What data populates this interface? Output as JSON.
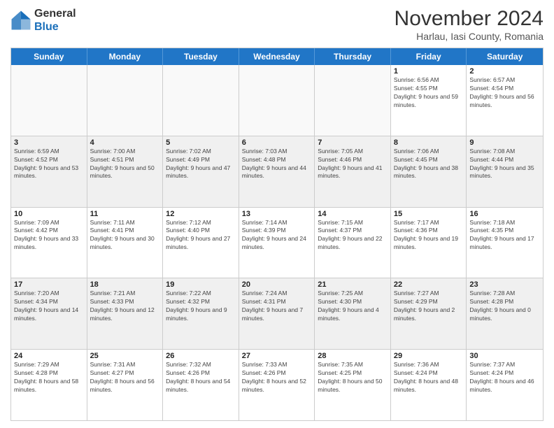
{
  "logo": {
    "general": "General",
    "blue": "Blue"
  },
  "title": "November 2024",
  "location": "Harlau, Iasi County, Romania",
  "header_days": [
    "Sunday",
    "Monday",
    "Tuesday",
    "Wednesday",
    "Thursday",
    "Friday",
    "Saturday"
  ],
  "rows": [
    [
      {
        "day": "",
        "info": ""
      },
      {
        "day": "",
        "info": ""
      },
      {
        "day": "",
        "info": ""
      },
      {
        "day": "",
        "info": ""
      },
      {
        "day": "",
        "info": ""
      },
      {
        "day": "1",
        "info": "Sunrise: 6:56 AM\nSunset: 4:55 PM\nDaylight: 9 hours and 59 minutes."
      },
      {
        "day": "2",
        "info": "Sunrise: 6:57 AM\nSunset: 4:54 PM\nDaylight: 9 hours and 56 minutes."
      }
    ],
    [
      {
        "day": "3",
        "info": "Sunrise: 6:59 AM\nSunset: 4:52 PM\nDaylight: 9 hours and 53 minutes."
      },
      {
        "day": "4",
        "info": "Sunrise: 7:00 AM\nSunset: 4:51 PM\nDaylight: 9 hours and 50 minutes."
      },
      {
        "day": "5",
        "info": "Sunrise: 7:02 AM\nSunset: 4:49 PM\nDaylight: 9 hours and 47 minutes."
      },
      {
        "day": "6",
        "info": "Sunrise: 7:03 AM\nSunset: 4:48 PM\nDaylight: 9 hours and 44 minutes."
      },
      {
        "day": "7",
        "info": "Sunrise: 7:05 AM\nSunset: 4:46 PM\nDaylight: 9 hours and 41 minutes."
      },
      {
        "day": "8",
        "info": "Sunrise: 7:06 AM\nSunset: 4:45 PM\nDaylight: 9 hours and 38 minutes."
      },
      {
        "day": "9",
        "info": "Sunrise: 7:08 AM\nSunset: 4:44 PM\nDaylight: 9 hours and 35 minutes."
      }
    ],
    [
      {
        "day": "10",
        "info": "Sunrise: 7:09 AM\nSunset: 4:42 PM\nDaylight: 9 hours and 33 minutes."
      },
      {
        "day": "11",
        "info": "Sunrise: 7:11 AM\nSunset: 4:41 PM\nDaylight: 9 hours and 30 minutes."
      },
      {
        "day": "12",
        "info": "Sunrise: 7:12 AM\nSunset: 4:40 PM\nDaylight: 9 hours and 27 minutes."
      },
      {
        "day": "13",
        "info": "Sunrise: 7:14 AM\nSunset: 4:39 PM\nDaylight: 9 hours and 24 minutes."
      },
      {
        "day": "14",
        "info": "Sunrise: 7:15 AM\nSunset: 4:37 PM\nDaylight: 9 hours and 22 minutes."
      },
      {
        "day": "15",
        "info": "Sunrise: 7:17 AM\nSunset: 4:36 PM\nDaylight: 9 hours and 19 minutes."
      },
      {
        "day": "16",
        "info": "Sunrise: 7:18 AM\nSunset: 4:35 PM\nDaylight: 9 hours and 17 minutes."
      }
    ],
    [
      {
        "day": "17",
        "info": "Sunrise: 7:20 AM\nSunset: 4:34 PM\nDaylight: 9 hours and 14 minutes."
      },
      {
        "day": "18",
        "info": "Sunrise: 7:21 AM\nSunset: 4:33 PM\nDaylight: 9 hours and 12 minutes."
      },
      {
        "day": "19",
        "info": "Sunrise: 7:22 AM\nSunset: 4:32 PM\nDaylight: 9 hours and 9 minutes."
      },
      {
        "day": "20",
        "info": "Sunrise: 7:24 AM\nSunset: 4:31 PM\nDaylight: 9 hours and 7 minutes."
      },
      {
        "day": "21",
        "info": "Sunrise: 7:25 AM\nSunset: 4:30 PM\nDaylight: 9 hours and 4 minutes."
      },
      {
        "day": "22",
        "info": "Sunrise: 7:27 AM\nSunset: 4:29 PM\nDaylight: 9 hours and 2 minutes."
      },
      {
        "day": "23",
        "info": "Sunrise: 7:28 AM\nSunset: 4:28 PM\nDaylight: 9 hours and 0 minutes."
      }
    ],
    [
      {
        "day": "24",
        "info": "Sunrise: 7:29 AM\nSunset: 4:28 PM\nDaylight: 8 hours and 58 minutes."
      },
      {
        "day": "25",
        "info": "Sunrise: 7:31 AM\nSunset: 4:27 PM\nDaylight: 8 hours and 56 minutes."
      },
      {
        "day": "26",
        "info": "Sunrise: 7:32 AM\nSunset: 4:26 PM\nDaylight: 8 hours and 54 minutes."
      },
      {
        "day": "27",
        "info": "Sunrise: 7:33 AM\nSunset: 4:26 PM\nDaylight: 8 hours and 52 minutes."
      },
      {
        "day": "28",
        "info": "Sunrise: 7:35 AM\nSunset: 4:25 PM\nDaylight: 8 hours and 50 minutes."
      },
      {
        "day": "29",
        "info": "Sunrise: 7:36 AM\nSunset: 4:24 PM\nDaylight: 8 hours and 48 minutes."
      },
      {
        "day": "30",
        "info": "Sunrise: 7:37 AM\nSunset: 4:24 PM\nDaylight: 8 hours and 46 minutes."
      }
    ]
  ]
}
